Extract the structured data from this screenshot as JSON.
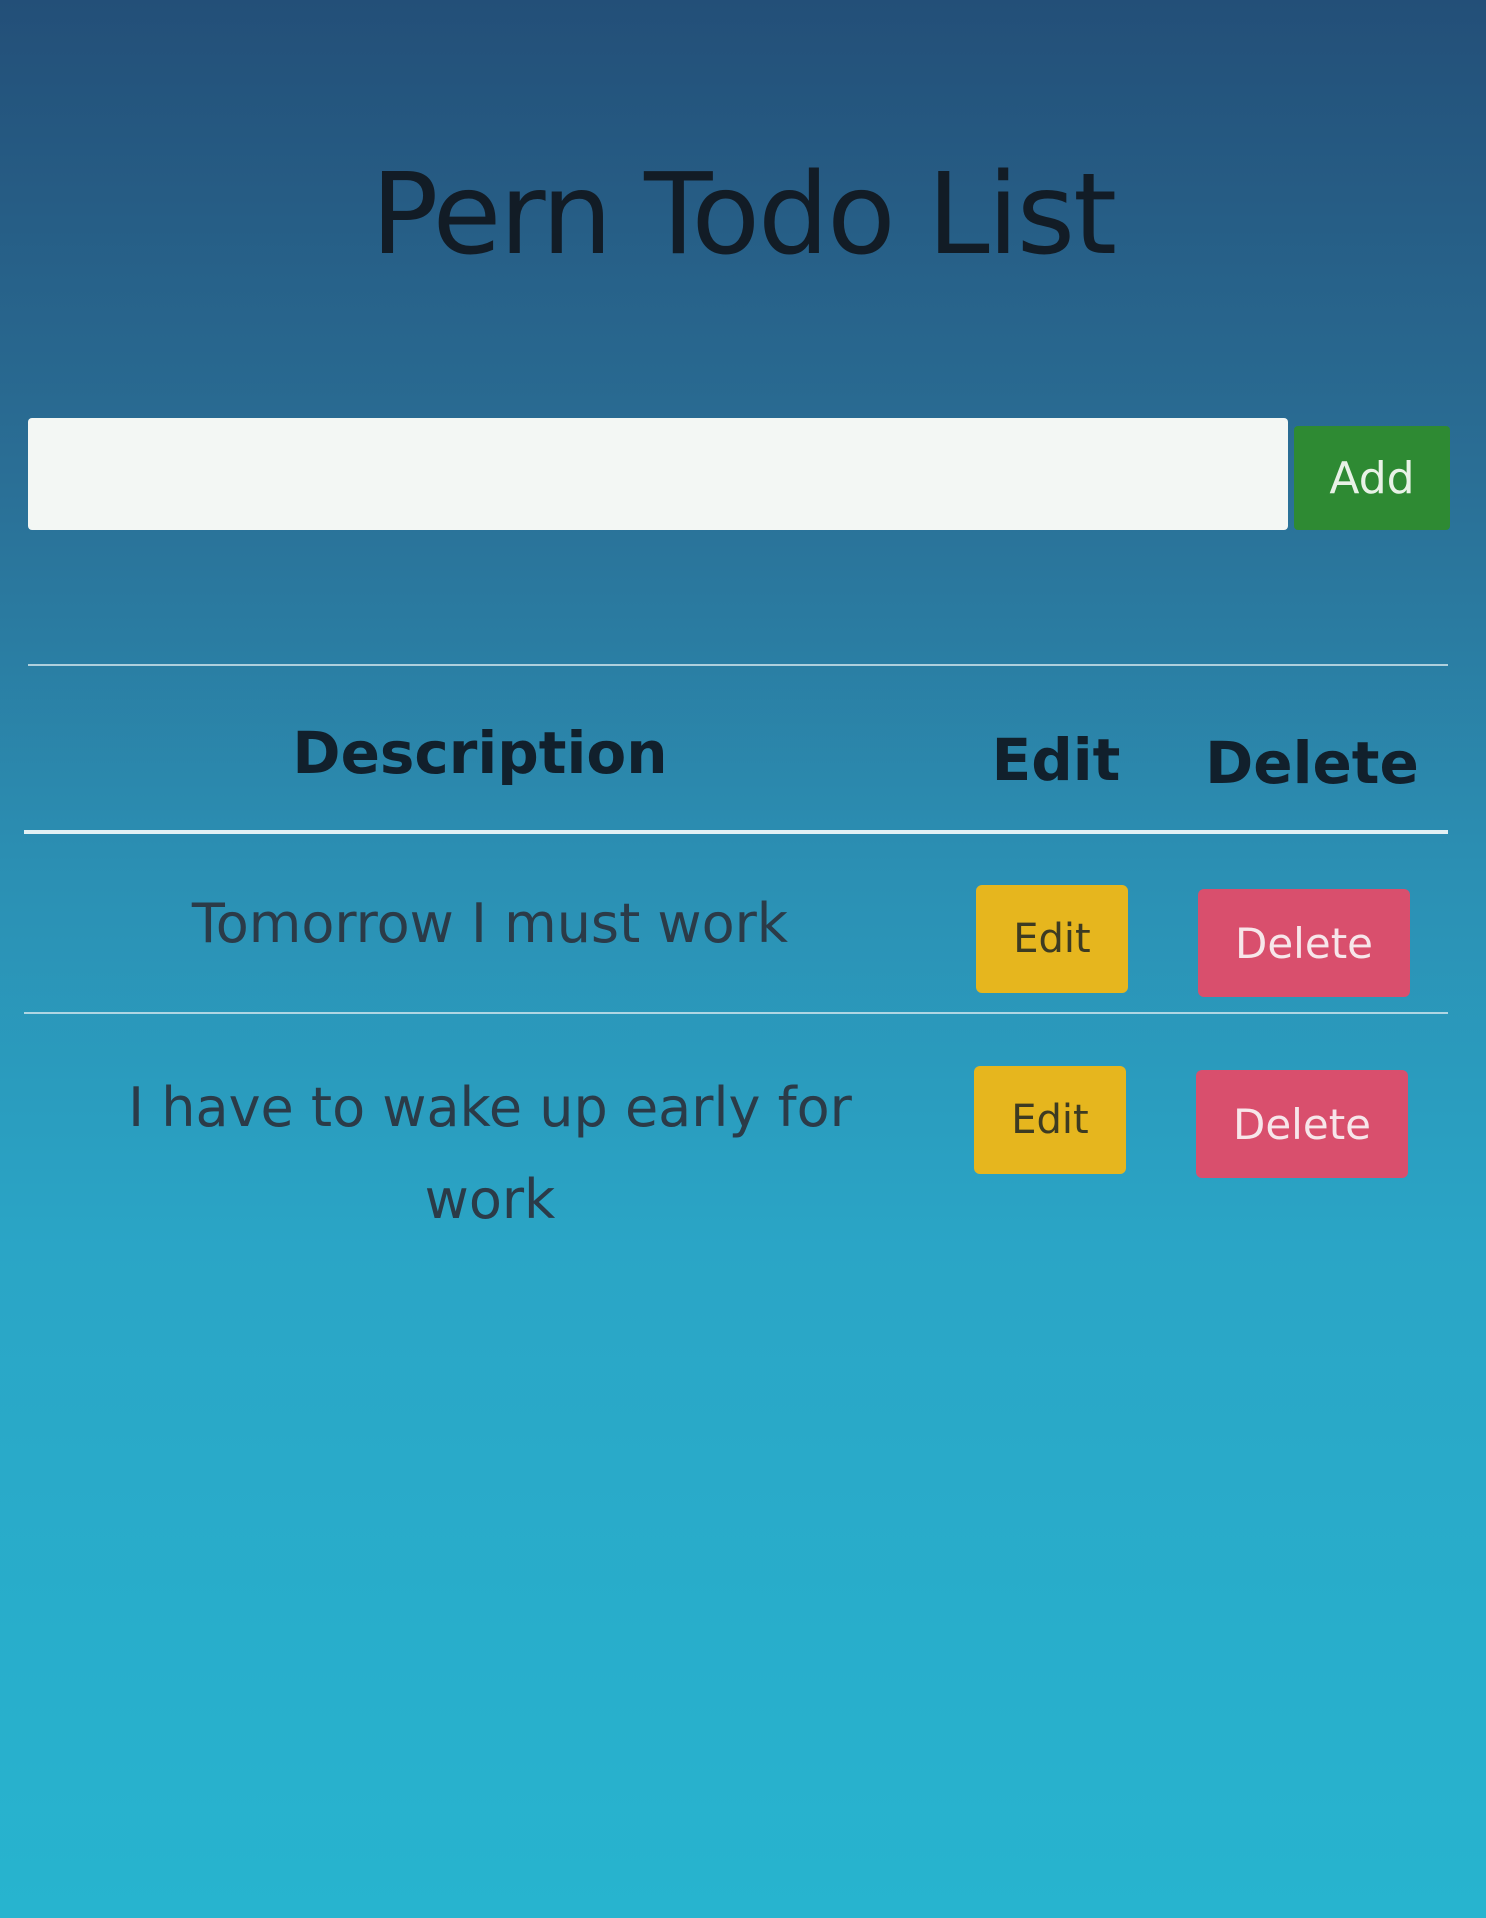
{
  "app": {
    "title": "Pern Todo List"
  },
  "form": {
    "input_value": "",
    "input_placeholder": "",
    "add_label": "Add"
  },
  "table": {
    "headers": [
      "Description",
      "Edit",
      "Delete"
    ],
    "rows": [
      {
        "description": "Tomorrow I must work",
        "edit_label": "Edit",
        "delete_label": "Delete"
      },
      {
        "description": "I have to wake up early for work",
        "edit_label": "Edit",
        "delete_label": "Delete"
      }
    ]
  },
  "colors": {
    "background_top": "#234f78",
    "background_bottom": "#27b4cf",
    "add_button": "#2e8a33",
    "edit_button": "#e6b61e",
    "delete_button": "#d94f6d"
  }
}
